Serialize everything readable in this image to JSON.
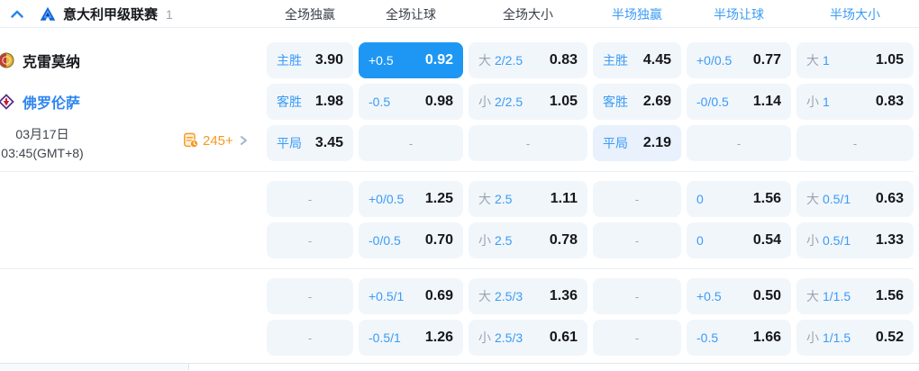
{
  "header": {
    "league": "意大利甲级联赛",
    "match_count": "1",
    "columns": [
      {
        "label": "全场独赢",
        "accent": false
      },
      {
        "label": "全场让球",
        "accent": false
      },
      {
        "label": "全场大小",
        "accent": false
      },
      {
        "label": "半场独赢",
        "accent": true
      },
      {
        "label": "半场让球",
        "accent": true
      },
      {
        "label": "半场大小",
        "accent": true
      }
    ]
  },
  "match": {
    "home_team": "克雷莫纳",
    "away_team": "佛罗伦萨",
    "date": "03月17日",
    "time": "03:45(GMT+8)",
    "markets_count": "245+"
  },
  "ui": {
    "dash": "-"
  },
  "colors": {
    "accent_blue": "#3b9bf6",
    "selected_cell_bg": "#1d97f3",
    "cell_bg": "#f1f6fb",
    "tint_cell_bg": "#e8f1fc",
    "odds_text": "#15171a",
    "muted_gray": "#9ba4b0",
    "away_team_blue": "#2e86f0",
    "markets_orange": "#f5991f"
  },
  "odds_rows": [
    {
      "group": 1,
      "cells": [
        {
          "type": "label-odds",
          "label": "主胜",
          "odds": "3.90"
        },
        {
          "type": "hcap-odds",
          "hcap": "+0.5",
          "odds": "0.92",
          "selected": true
        },
        {
          "type": "ou-odds",
          "side": "大",
          "line": "2/2.5",
          "odds": "0.83"
        },
        {
          "type": "label-odds",
          "label": "主胜",
          "odds": "4.45"
        },
        {
          "type": "hcap-odds",
          "hcap": "+0/0.5",
          "odds": "0.77"
        },
        {
          "type": "ou-odds",
          "side": "大",
          "line": "1",
          "odds": "1.05"
        }
      ]
    },
    {
      "group": 1,
      "cells": [
        {
          "type": "label-odds",
          "label": "客胜",
          "odds": "1.98"
        },
        {
          "type": "hcap-odds",
          "hcap": "-0.5",
          "odds": "0.98"
        },
        {
          "type": "ou-odds",
          "side": "小",
          "line": "2/2.5",
          "odds": "1.05"
        },
        {
          "type": "label-odds",
          "label": "客胜",
          "odds": "2.69"
        },
        {
          "type": "hcap-odds",
          "hcap": "-0/0.5",
          "odds": "1.14"
        },
        {
          "type": "ou-odds",
          "side": "小",
          "line": "1",
          "odds": "0.83"
        }
      ]
    },
    {
      "group": 1,
      "cells": [
        {
          "type": "label-odds",
          "label": "平局",
          "odds": "3.45"
        },
        {
          "type": "dash"
        },
        {
          "type": "dash"
        },
        {
          "type": "label-odds",
          "label": "平局",
          "odds": "2.19",
          "tint": true
        },
        {
          "type": "dash"
        },
        {
          "type": "dash"
        }
      ]
    },
    {
      "group": 2,
      "cells": [
        {
          "type": "dash"
        },
        {
          "type": "hcap-odds",
          "hcap": "+0/0.5",
          "odds": "1.25"
        },
        {
          "type": "ou-odds",
          "side": "大",
          "line": "2.5",
          "odds": "1.11"
        },
        {
          "type": "dash"
        },
        {
          "type": "hcap-odds",
          "hcap": "0",
          "odds": "1.56"
        },
        {
          "type": "ou-odds",
          "side": "大",
          "line": "0.5/1",
          "odds": "0.63"
        }
      ]
    },
    {
      "group": 2,
      "cells": [
        {
          "type": "dash"
        },
        {
          "type": "hcap-odds",
          "hcap": "-0/0.5",
          "odds": "0.70"
        },
        {
          "type": "ou-odds",
          "side": "小",
          "line": "2.5",
          "odds": "0.78"
        },
        {
          "type": "dash"
        },
        {
          "type": "hcap-odds",
          "hcap": "0",
          "odds": "0.54"
        },
        {
          "type": "ou-odds",
          "side": "小",
          "line": "0.5/1",
          "odds": "1.33"
        }
      ]
    },
    {
      "group": 3,
      "cells": [
        {
          "type": "dash"
        },
        {
          "type": "hcap-odds",
          "hcap": "+0.5/1",
          "odds": "0.69"
        },
        {
          "type": "ou-odds",
          "side": "大",
          "line": "2.5/3",
          "odds": "1.36"
        },
        {
          "type": "dash"
        },
        {
          "type": "hcap-odds",
          "hcap": "+0.5",
          "odds": "0.50"
        },
        {
          "type": "ou-odds",
          "side": "大",
          "line": "1/1.5",
          "odds": "1.56"
        }
      ]
    },
    {
      "group": 3,
      "cells": [
        {
          "type": "dash"
        },
        {
          "type": "hcap-odds",
          "hcap": "-0.5/1",
          "odds": "1.26"
        },
        {
          "type": "ou-odds",
          "side": "小",
          "line": "2.5/3",
          "odds": "0.61"
        },
        {
          "type": "dash"
        },
        {
          "type": "hcap-odds",
          "hcap": "-0.5",
          "odds": "1.66"
        },
        {
          "type": "ou-odds",
          "side": "小",
          "line": "1/1.5",
          "odds": "0.52"
        }
      ]
    }
  ]
}
